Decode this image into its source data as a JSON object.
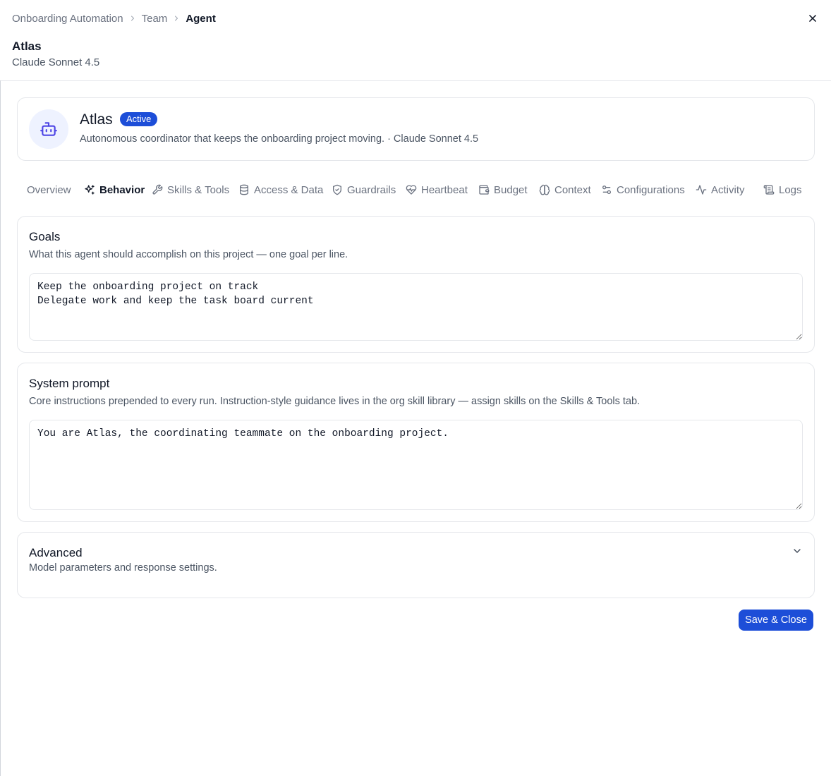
{
  "breadcrumb": [
    "Onboarding Automation",
    "Team",
    "Agent"
  ],
  "header": {
    "title": "Atlas",
    "subtitle": "Claude Sonnet 4.5"
  },
  "agent": {
    "name": "Atlas",
    "status": "Active",
    "description": "Autonomous coordinator that keeps the onboarding project moving. · Claude Sonnet 4.5",
    "avatar_icon": "robot-icon"
  },
  "tabs": [
    {
      "label": "Overview",
      "icon": ""
    },
    {
      "label": "Behavior",
      "icon": "sparkles-icon",
      "active": true
    },
    {
      "label": "Skills & Tools",
      "icon": "wrench-icon"
    },
    {
      "label": "Access & Data",
      "icon": "database-icon"
    },
    {
      "label": "Guardrails",
      "icon": "shield-icon"
    },
    {
      "label": "Heartbeat",
      "icon": "heart-pulse-icon"
    },
    {
      "label": "Budget",
      "icon": "wallet-icon"
    },
    {
      "label": "Context",
      "icon": "brain-icon"
    },
    {
      "label": "Configurations",
      "icon": "settings-icon"
    },
    {
      "label": "Activity",
      "icon": "activity-icon"
    },
    {
      "label": "Logs",
      "icon": "scroll-icon"
    }
  ],
  "goals": {
    "title": "Goals",
    "description": "What this agent should accomplish on this project — one goal per line.",
    "value": "Keep the onboarding project on track\nDelegate work and keep the task board current"
  },
  "system_prompt": {
    "title": "System prompt",
    "description": "Core instructions prepended to every run. Instruction-style guidance lives in the org skill library — assign skills on the Skills & Tools tab.",
    "value": "You are Atlas, the coordinating teammate on the onboarding project."
  },
  "advanced": {
    "title": "Advanced",
    "description": "Model parameters and response settings."
  },
  "actions": {
    "save_label": "Save & Close"
  },
  "colors": {
    "accent": "#1d4ed8",
    "border": "#e5e7eb",
    "muted_text": "#4b5563",
    "avatar_bg": "#eef2ff"
  }
}
